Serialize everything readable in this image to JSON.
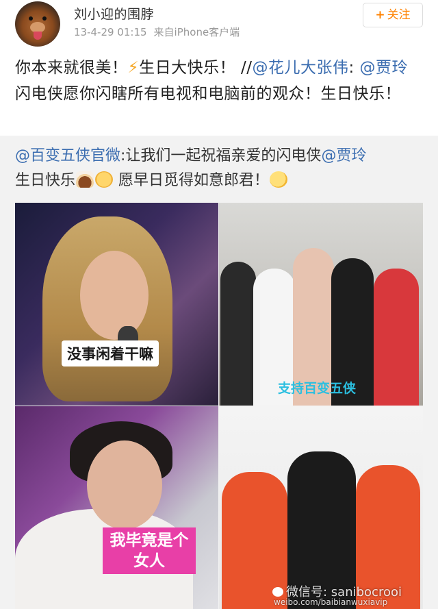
{
  "header": {
    "username": "刘小迎的围脖",
    "timestamp": "13-4-29 01:15",
    "source": "来自iPhone客户端",
    "follow_label": "关注",
    "follow_icon": "plus-icon"
  },
  "post": {
    "text_part1": "你本来就很美！",
    "bolt_emoji": "⚡",
    "text_part2": "生日大快乐！ //",
    "mention1": "@花儿大张伟",
    "text_colon": ": ",
    "mention2": "@贾玲",
    "text_part3": " 闪电侠愿你闪瞎所有电视和电脑前的观众！生日快乐！"
  },
  "repost": {
    "mention_source": "@百变五侠官微",
    "text_part1": ":让我们一起祝福亲爱的闪电侠",
    "mention_target": "@贾玲",
    "text_part2": "生日快乐",
    "text_part3": " 愿早日觅得如意郎君！"
  },
  "images": [
    {
      "caption": "没事闲着干嘛"
    },
    {
      "caption": "支持百变五侠"
    },
    {
      "caption": "我毕竟是个女人"
    },
    {
      "caption": ""
    }
  ],
  "watermark": {
    "text": "微信号: sanibocrooi",
    "url": "weibo.com/baibianwuxiavip"
  }
}
